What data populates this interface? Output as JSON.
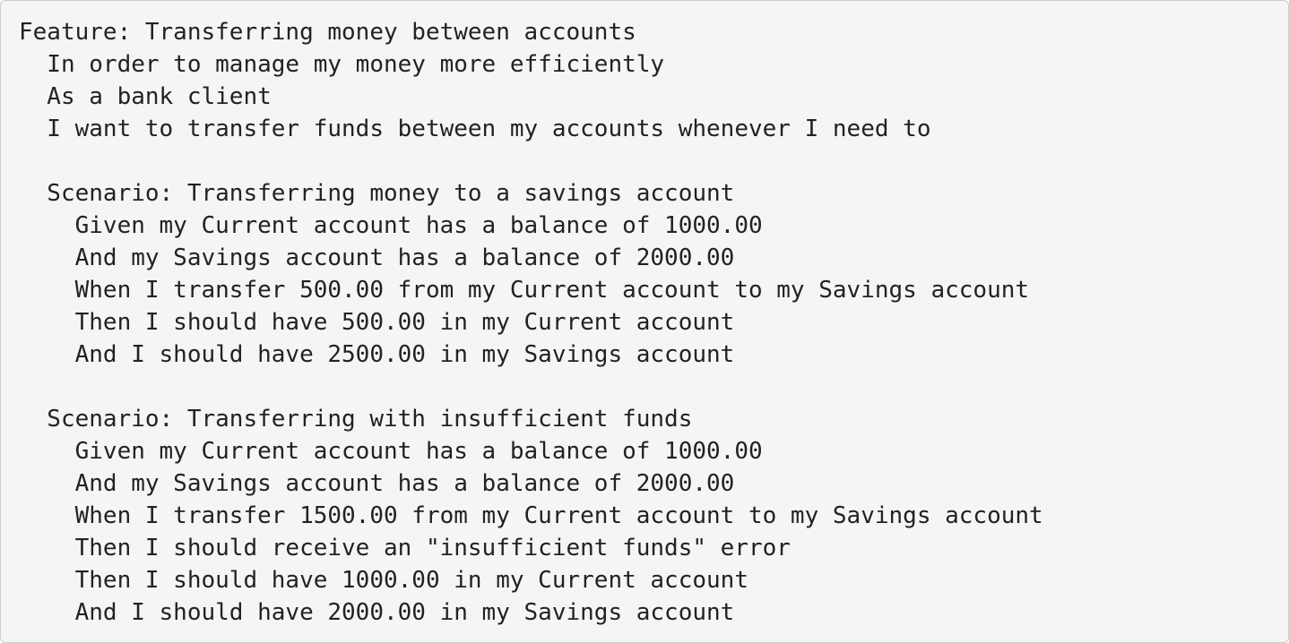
{
  "code_block": {
    "lines": [
      "Feature: Transferring money between accounts",
      "  In order to manage my money more efficiently",
      "  As a bank client",
      "  I want to transfer funds between my accounts whenever I need to",
      "",
      "  Scenario: Transferring money to a savings account",
      "    Given my Current account has a balance of 1000.00",
      "    And my Savings account has a balance of 2000.00",
      "    When I transfer 500.00 from my Current account to my Savings account",
      "    Then I should have 500.00 in my Current account",
      "    And I should have 2500.00 in my Savings account",
      "",
      "  Scenario: Transferring with insufficient funds",
      "    Given my Current account has a balance of 1000.00",
      "    And my Savings account has a balance of 2000.00",
      "    When I transfer 1500.00 from my Current account to my Savings account",
      "    Then I should receive an \"insufficient funds\" error",
      "    Then I should have 1000.00 in my Current account",
      "    And I should have 2000.00 in my Savings account"
    ]
  }
}
